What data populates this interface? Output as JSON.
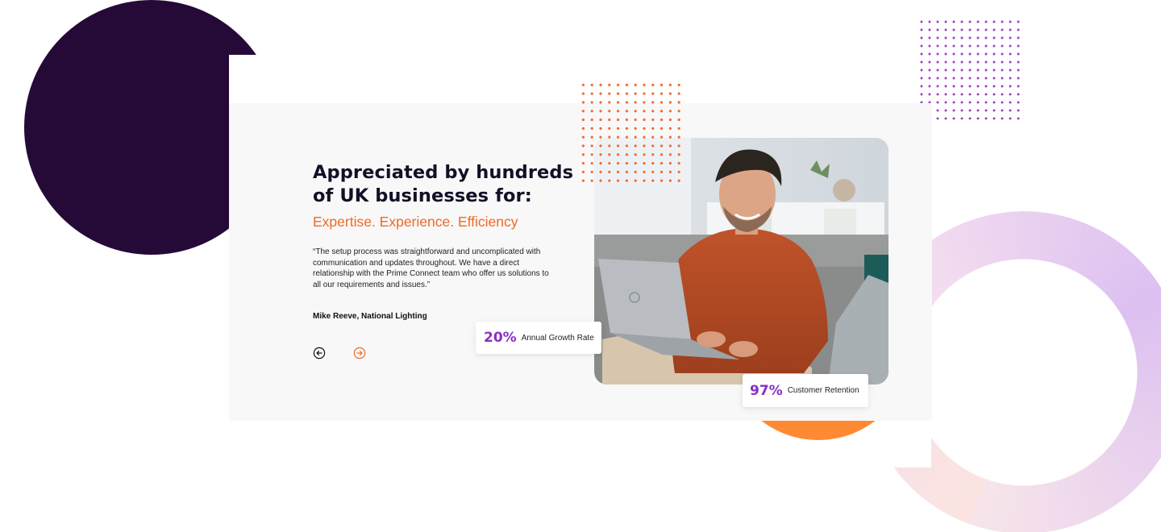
{
  "testimonial": {
    "headline": "Appreciated by hundreds of UK businesses for:",
    "subheadline": "Expertise. Experience. Efficiency",
    "quote": "“The setup process was straightforward and uncomplicated with communication and updates throughout. We have a direct relationship with the Prime Connect team who offer us solutions to all our requirements and issues.”",
    "author": "Mike Reeve, National Lighting"
  },
  "navigation": {
    "prev_icon": "arrow-left-circle-icon",
    "next_icon": "arrow-right-circle-icon"
  },
  "stats": [
    {
      "value": "20%",
      "label": "Annual Growth Rate"
    },
    {
      "value": "97%",
      "label": "Customer Retention"
    }
  ],
  "colors": {
    "headline": "#111126",
    "accent_orange": "#ee6a28",
    "stat_purple": "#8a2fc4",
    "dark_circle": "#250a38"
  }
}
